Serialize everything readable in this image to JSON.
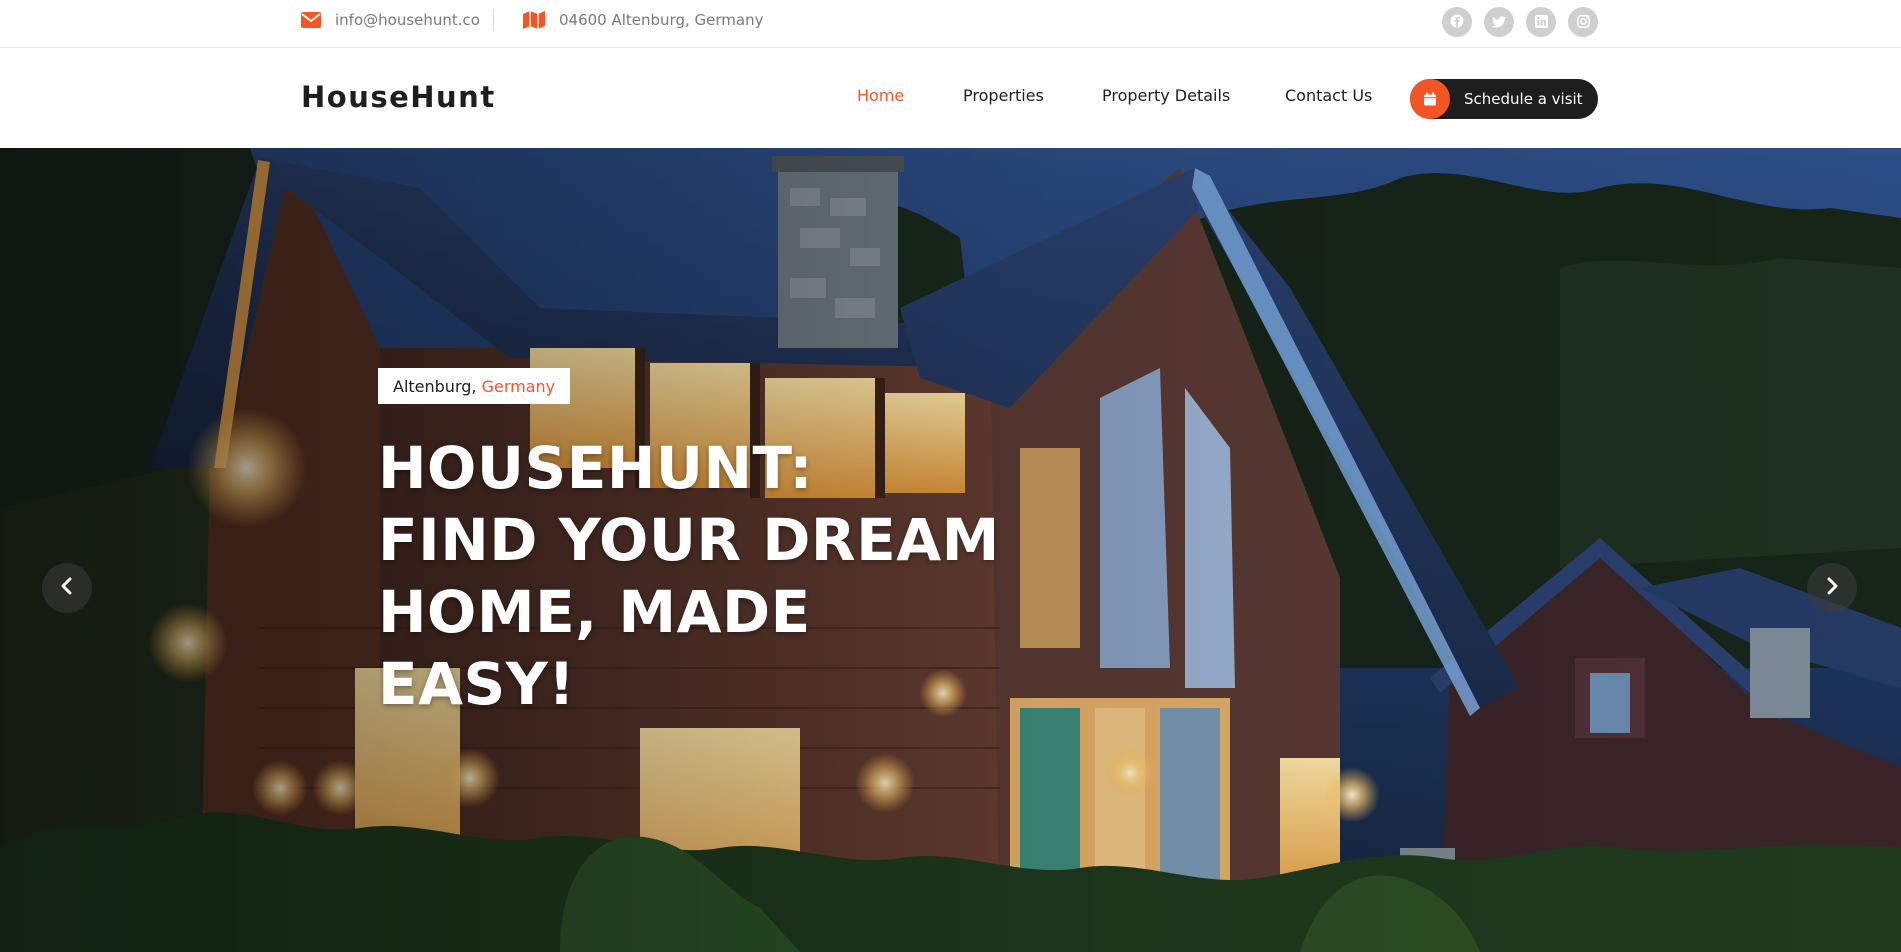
{
  "topbar": {
    "email": "info@househunt.co",
    "address": "04600 Altenburg, Germany",
    "socials": [
      "facebook-icon",
      "twitter-icon",
      "linkedin-icon",
      "instagram-icon"
    ]
  },
  "header": {
    "logo": "HouseHunt",
    "nav": [
      {
        "label": "Home",
        "active": true
      },
      {
        "label": "Properties",
        "active": false
      },
      {
        "label": "Property Details",
        "active": false
      },
      {
        "label": "Contact Us",
        "active": false
      }
    ],
    "cta_label": "Schedule a visit"
  },
  "hero": {
    "location_city": "Altenburg,",
    "location_country": "Germany",
    "headline_lines": [
      "HOUSEHUNT:",
      "FIND YOUR DREAM",
      "HOME, MADE",
      "EASY!"
    ]
  },
  "colors": {
    "accent": "#f35525",
    "dark": "#1e1e1e",
    "muted_text": "#7a7a7a",
    "social_bg": "#cfcfcf"
  }
}
